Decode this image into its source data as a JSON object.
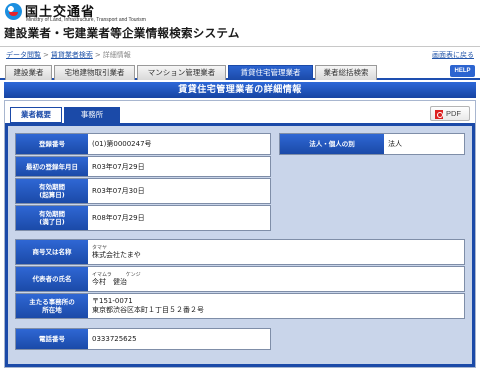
{
  "header": {
    "ministry_jp": "国土交通省",
    "ministry_en": "Ministry of Land, Infrastructure, Transport and Tourism",
    "system_title": "建設業者・宅建業者等企業情報検索システム"
  },
  "breadcrumb": {
    "items": [
      "データ閲覧",
      "賃貸業者検索",
      "詳細情報"
    ],
    "back": "画面表に戻る"
  },
  "tabs": {
    "items": [
      "建設業者",
      "宅地建物取引業者",
      "マンション管理業者",
      "賃貸住宅管理業者",
      "業者総括検索"
    ],
    "active": "賃貸住宅管理業者",
    "help": "HELP"
  },
  "detail_title": "賃貸住宅管理業者の詳細情報",
  "subtabs": [
    "業者概要",
    "事務所"
  ],
  "pdf": {
    "label": "PDF",
    "icon": "pdf-icon"
  },
  "info": {
    "reg_no_label": "登録番号",
    "reg_no": "(01)第0000247号",
    "first_reg_label": "最初の登録年月日",
    "first_reg": "R03年07月29日",
    "valid_start_label1": "有効期間",
    "valid_start_label2": "(起算日)",
    "valid_start": "R03年07月30日",
    "valid_end_label1": "有効期間",
    "valid_end_label2": "(満了日)",
    "valid_end": "R08年07月29日",
    "entity_label": "法人・個人の別",
    "entity": "法人",
    "trade_name_label": "商号又は名称",
    "trade_name_kana": "タマヤ",
    "trade_name": "株式会社たまや",
    "rep_label": "代表者の氏名",
    "rep_kana_last": "イマムラ",
    "rep_kana_first": "ケンジ",
    "rep_name": "今村　健治",
    "office_label1": "主たる事務所の",
    "office_label2": "所在地",
    "office_zip": "〒151-0071",
    "office_address": "東京都渋谷区本町１丁目５２番２号",
    "phone_label": "電話番号",
    "phone": "0333725625"
  },
  "colors": {
    "primary": "#1b4aa8",
    "panel_bg": "#c9d5ea"
  }
}
